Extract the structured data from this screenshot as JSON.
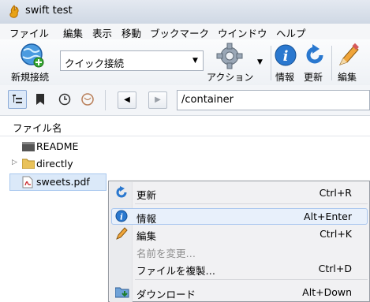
{
  "window": {
    "title": "swift test"
  },
  "menu": [
    "ファイル",
    "編集",
    "表示",
    "移動",
    "ブックマーク",
    "ウインドウ",
    "ヘルプ"
  ],
  "toolbar": {
    "new_connection": "新規接続",
    "quick_connect": "クイック接続",
    "action": "アクション",
    "info": "情報",
    "refresh": "更新",
    "edit": "編集"
  },
  "nav": {
    "path": "/container"
  },
  "browser": {
    "column_header": "ファイル名",
    "rows": [
      "README",
      "directly",
      "sweets.pdf"
    ]
  },
  "context_menu": {
    "items": [
      {
        "label": "更新",
        "shortcut": "Ctrl+R"
      },
      {
        "label": "情報",
        "shortcut": "Alt+Enter"
      },
      {
        "label": "編集",
        "shortcut": "Ctrl+K"
      },
      {
        "label": "名前を変更…",
        "shortcut": ""
      },
      {
        "label": "ファイルを複製…",
        "shortcut": "Ctrl+D"
      },
      {
        "label": "ダウンロード",
        "shortcut": "Alt+Down"
      }
    ]
  },
  "colors": {
    "accent": "#1f6fc5",
    "selection": "#dbe9f9",
    "menu_bg": "#f1f1f3"
  }
}
